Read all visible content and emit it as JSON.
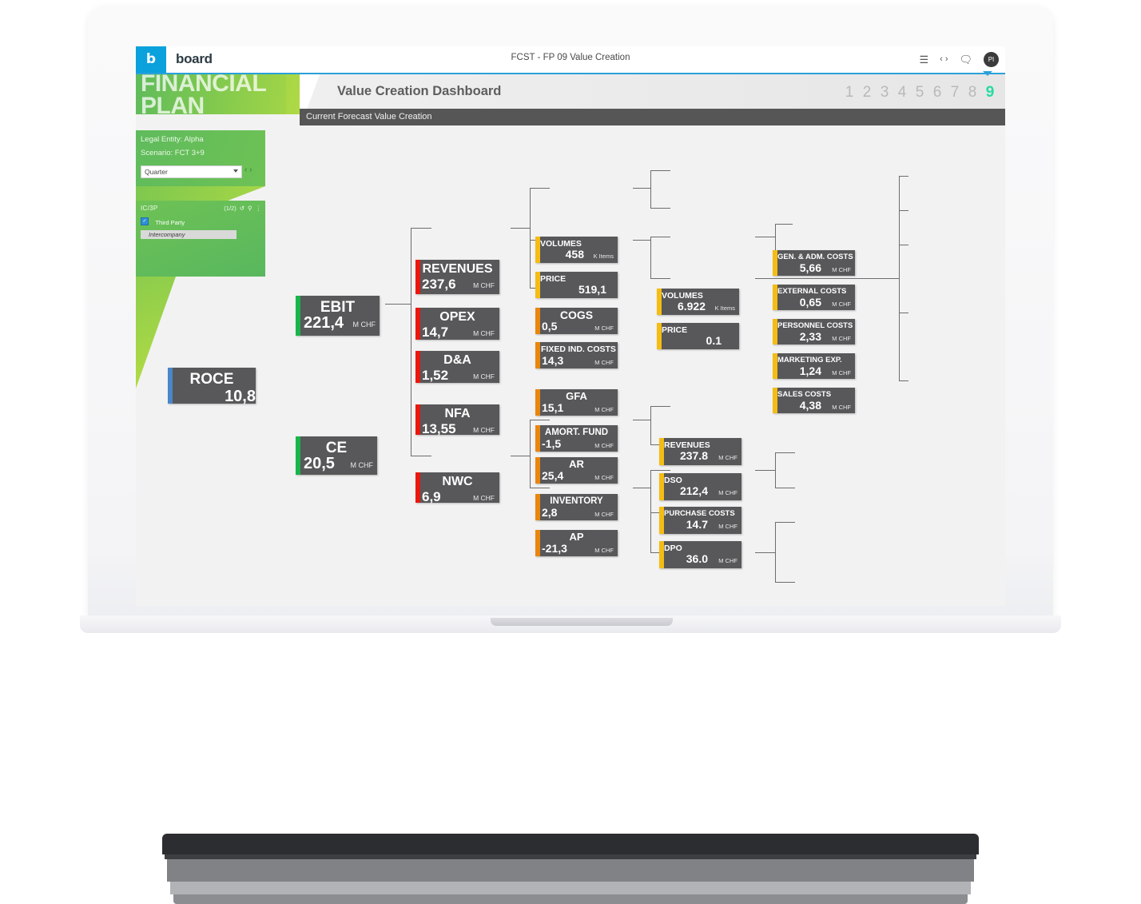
{
  "app": {
    "brand_letter": "b",
    "brand_word": "board",
    "title": "FCST - FP 09 Value Creation",
    "icons": {
      "menu": "menu-icon",
      "nav": "prev-next-icon",
      "comment": "comment-icon",
      "avatar_initials": "PI"
    }
  },
  "banner": {
    "line1": "FINANCIAL",
    "line2": "PLAN",
    "dashboard_title": "Value Creation Dashboard",
    "sub_bar": "Current Forecast Value Creation",
    "pages": [
      "1",
      "2",
      "3",
      "4",
      "5",
      "6",
      "7",
      "8",
      "9"
    ],
    "active_page": "9"
  },
  "filters": {
    "legal_entity": "Legal Entity: Alpha",
    "scenario": "Scenario: FCT 3+9",
    "period_select": "Quarter",
    "period_prev": "‹",
    "period_next": "›",
    "ic3p_label": "IC/3P",
    "ic3p_count": "(1/2)",
    "ic3p_reset_icon": "reset-icon",
    "ic3p_search_icon": "search-icon",
    "ic3p_more_icon": "more-vertical-icon",
    "ic3p_option1": "Third Party",
    "ic3p_option2": "Intercompany"
  },
  "colors": {
    "accent_blue": "#4a86c8",
    "accent_green": "#19b54a",
    "accent_red": "#e8180f",
    "accent_orange": "#e8860f",
    "accent_yellow": "#f5bc13",
    "node_bg": "#58585a",
    "brand_blue": "#0aa1dd",
    "active_page": "#24dba0"
  },
  "chart_data": {
    "type": "diagram",
    "title": "Value Creation Dashboard",
    "subtitle": "Current Forecast Value Creation",
    "nodes": [
      {
        "id": "roce",
        "title": "ROCE",
        "value": "10,8",
        "unit": "",
        "accent": "blue"
      },
      {
        "id": "ebit",
        "title": "EBIT",
        "value": "221,4",
        "unit": "M CHF",
        "accent": "green"
      },
      {
        "id": "ce",
        "title": "CE",
        "value": "20,5",
        "unit": "M CHF",
        "accent": "green"
      },
      {
        "id": "revenues",
        "title": "REVENUES",
        "value": "237,6",
        "unit": "M CHF",
        "accent": "red"
      },
      {
        "id": "opex",
        "title": "OPEX",
        "value": "14,7",
        "unit": "M CHF",
        "accent": "red"
      },
      {
        "id": "da",
        "title": "D&A",
        "value": "1,52",
        "unit": "M CHF",
        "accent": "red"
      },
      {
        "id": "nfa",
        "title": "NFA",
        "value": "13,55",
        "unit": "M CHF",
        "accent": "red"
      },
      {
        "id": "nwc",
        "title": "NWC",
        "value": "6,9",
        "unit": "M CHF",
        "accent": "red"
      },
      {
        "id": "volumes1",
        "title": "VOLUMES",
        "value": "458",
        "unit": "K Items",
        "accent": "yellow"
      },
      {
        "id": "price1",
        "title": "PRICE",
        "value": "519,1",
        "unit": "",
        "accent": "yellow"
      },
      {
        "id": "cogs",
        "title": "COGS",
        "value": "0,5",
        "unit": "M CHF",
        "accent": "orange"
      },
      {
        "id": "fixedind",
        "title": "FIXED IND. COSTS",
        "value": "14,3",
        "unit": "M CHF",
        "accent": "orange"
      },
      {
        "id": "volumes2",
        "title": "VOLUMES",
        "value": "6.922",
        "unit": "K Items",
        "accent": "yellow"
      },
      {
        "id": "price2",
        "title": "PRICE",
        "value": "0.1",
        "unit": "",
        "accent": "yellow"
      },
      {
        "id": "genadm",
        "title": "GEN. & ADM. COSTS",
        "value": "5,66",
        "unit": "M CHF",
        "accent": "yellow"
      },
      {
        "id": "external",
        "title": "EXTERNAL COSTS",
        "value": "0,65",
        "unit": "M CHF",
        "accent": "yellow"
      },
      {
        "id": "personnel",
        "title": "PERSONNEL COSTS",
        "value": "2,33",
        "unit": "M CHF",
        "accent": "yellow"
      },
      {
        "id": "marketing",
        "title": "MARKETING EXP.",
        "value": "1,24",
        "unit": "M CHF",
        "accent": "yellow"
      },
      {
        "id": "sales",
        "title": "SALES COSTS",
        "value": "4,38",
        "unit": "M CHF",
        "accent": "yellow"
      },
      {
        "id": "gfa",
        "title": "GFA",
        "value": "15,1",
        "unit": "M CHF",
        "accent": "orange"
      },
      {
        "id": "amort",
        "title": "AMORT. FUND",
        "value": "-1,5",
        "unit": "M CHF",
        "accent": "orange"
      },
      {
        "id": "ar",
        "title": "AR",
        "value": "25,4",
        "unit": "M CHF",
        "accent": "orange"
      },
      {
        "id": "inventory",
        "title": "INVENTORY",
        "value": "2,8",
        "unit": "M CHF",
        "accent": "orange"
      },
      {
        "id": "ap",
        "title": "AP",
        "value": "-21,3",
        "unit": "M CHF",
        "accent": "orange"
      },
      {
        "id": "revenues2",
        "title": "REVENUES",
        "value": "237.8",
        "unit": "M CHF",
        "accent": "yellow"
      },
      {
        "id": "dso",
        "title": "DSO",
        "value": "212,4",
        "unit": "M CHF",
        "accent": "yellow"
      },
      {
        "id": "purchase",
        "title": "PURCHASE COSTS",
        "value": "14.7",
        "unit": "M CHF",
        "accent": "yellow"
      },
      {
        "id": "dpo",
        "title": "DPO",
        "value": "36.0",
        "unit": "M CHF",
        "accent": "yellow"
      }
    ],
    "edges": [
      [
        "roce",
        "ebit"
      ],
      [
        "roce",
        "ce"
      ],
      [
        "ebit",
        "revenues"
      ],
      [
        "ebit",
        "opex"
      ],
      [
        "ebit",
        "da"
      ],
      [
        "ce",
        "nfa"
      ],
      [
        "ce",
        "nwc"
      ],
      [
        "revenues",
        "volumes1"
      ],
      [
        "revenues",
        "price1"
      ],
      [
        "opex",
        "cogs"
      ],
      [
        "opex",
        "fixedind"
      ],
      [
        "cogs",
        "volumes2"
      ],
      [
        "cogs",
        "price2"
      ],
      [
        "fixedind",
        "genadm"
      ],
      [
        "fixedind",
        "external"
      ],
      [
        "fixedind",
        "personnel"
      ],
      [
        "fixedind",
        "marketing"
      ],
      [
        "fixedind",
        "sales"
      ],
      [
        "nfa",
        "gfa"
      ],
      [
        "nfa",
        "amort"
      ],
      [
        "nwc",
        "ar"
      ],
      [
        "nwc",
        "inventory"
      ],
      [
        "nwc",
        "ap"
      ],
      [
        "ar",
        "revenues2"
      ],
      [
        "ar",
        "dso"
      ],
      [
        "ap",
        "purchase"
      ],
      [
        "ap",
        "dpo"
      ]
    ]
  }
}
